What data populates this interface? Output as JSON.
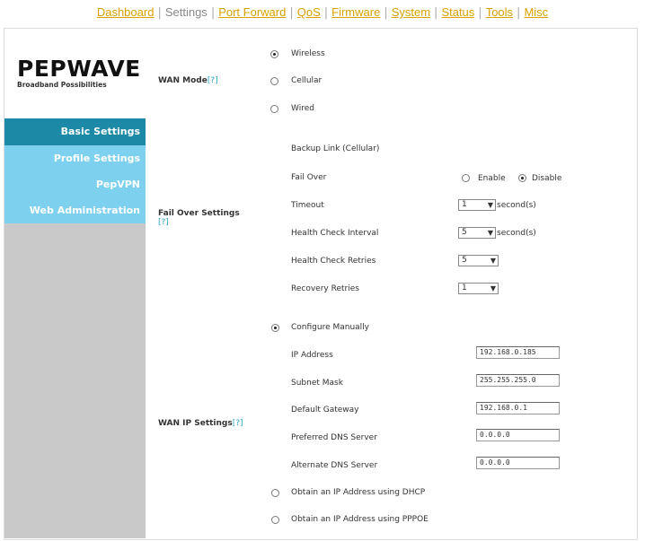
{
  "topnav": {
    "items": [
      "Dashboard",
      "Settings",
      "Port Forward",
      "QoS",
      "Firmware",
      "System",
      "Status",
      "Tools",
      "Misc"
    ],
    "separator": "|",
    "current": "Settings"
  },
  "sidebar": {
    "logo": "PEPWAVE",
    "tagline": "Broadband Possibilities",
    "items": [
      {
        "label": "Basic Settings",
        "active": true
      },
      {
        "label": "Profile Settings",
        "active": false
      },
      {
        "label": "PepVPN",
        "active": false
      },
      {
        "label": "Web Administration",
        "active": false
      }
    ]
  },
  "wan_mode": {
    "label": "WAN Mode",
    "help": "[?]",
    "options": [
      "Wireless",
      "Cellular",
      "Wired"
    ],
    "selected": "Wireless"
  },
  "failover": {
    "label": "Fail Over Settings",
    "help": "[?]",
    "backup_link": "Backup Link (Cellular)",
    "fail_over_label": "Fail Over",
    "enable_label": "Enable",
    "disable_label": "Disable",
    "fail_over_value": "Disable",
    "timeout_label": "Timeout",
    "timeout_value": "1",
    "timeout_unit": "second(s)",
    "hci_label": "Health Check Interval",
    "hci_value": "5",
    "hci_unit": "second(s)",
    "hcr_label": "Health Check Retries",
    "hcr_value": "5",
    "rr_label": "Recovery Retries",
    "rr_value": "1"
  },
  "wan_ip": {
    "label": "WAN IP Settings",
    "help": "[?]",
    "configure_manually": "Configure Manually",
    "ip_label": "IP Address",
    "ip_value": "192.168.0.185",
    "subnet_label": "Subnet Mask",
    "subnet_value": "255.255.255.0",
    "gateway_label": "Default Gateway",
    "gateway_value": "192.168.0.1",
    "pdns_label": "Preferred DNS Server",
    "pdns_value": "0.0.0.0",
    "adns_label": "Alternate DNS Server",
    "adns_value": "0.0.0.0",
    "dhcp_label": "Obtain an IP Address using DHCP",
    "pppoe_label": "Obtain an IP Address using PPPOE",
    "selected": "Configure Manually"
  }
}
